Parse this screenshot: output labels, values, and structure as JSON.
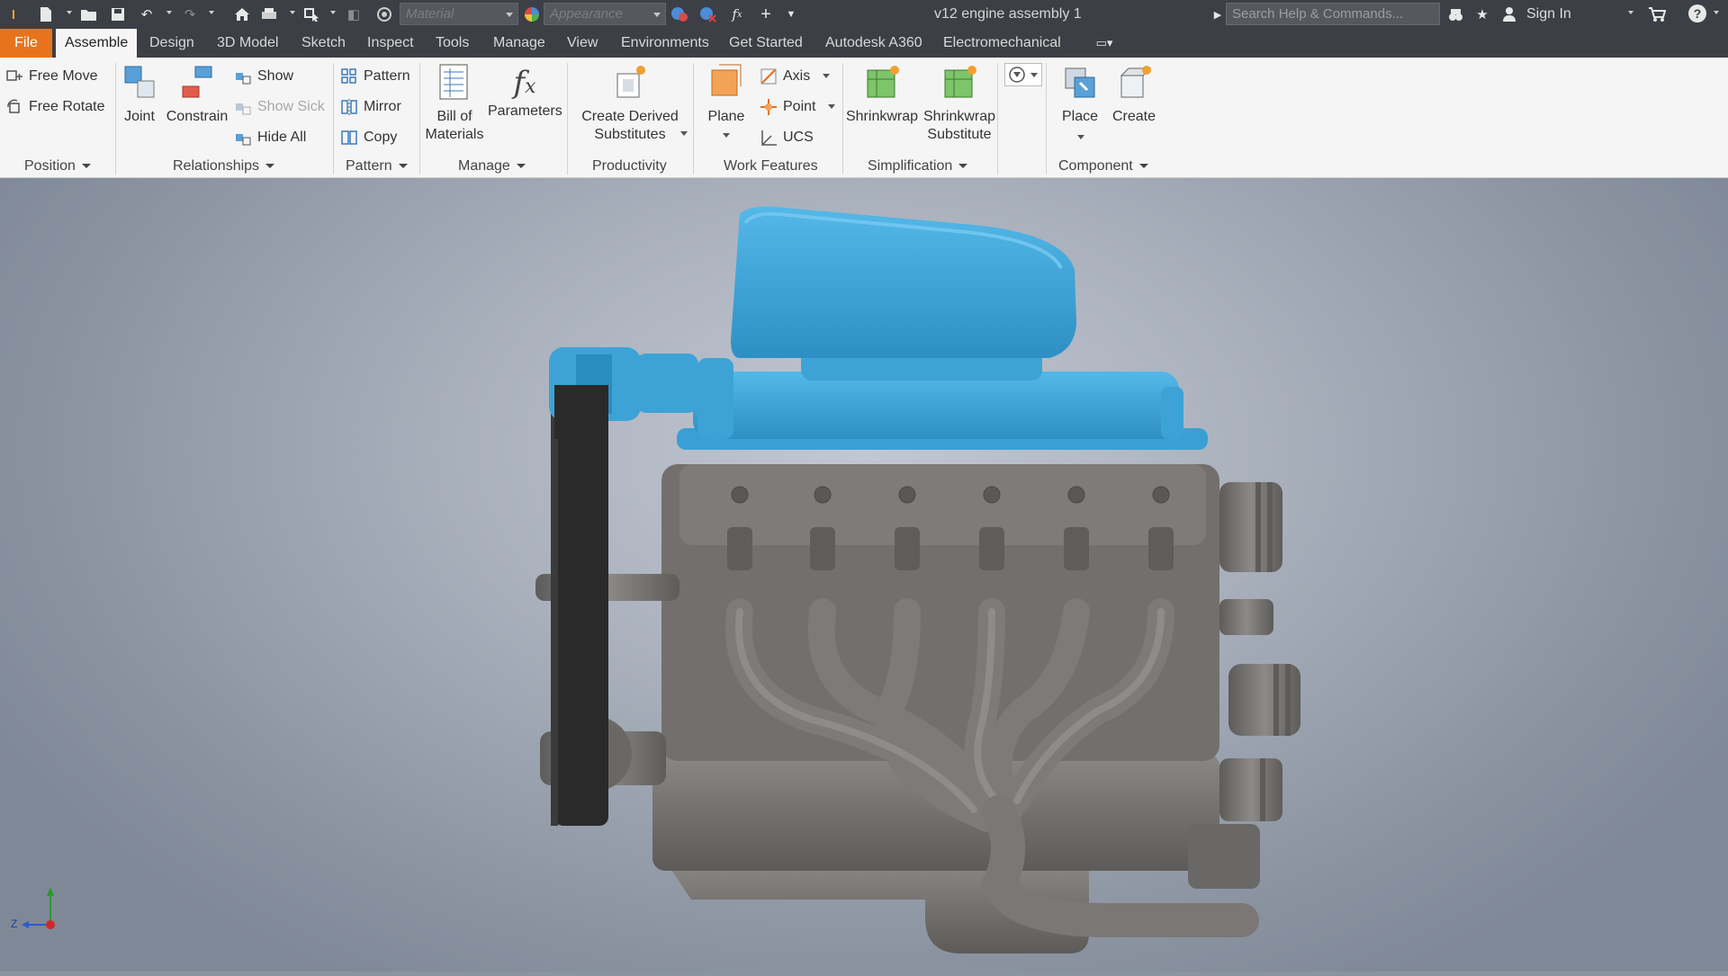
{
  "titlebar": {
    "document_title": "v12 engine assembly 1",
    "material_placeholder": "Material",
    "appearance_placeholder": "Appearance",
    "search_placeholder": "Search Help & Commands...",
    "sign_in": "Sign In",
    "help": "?"
  },
  "tabs": [
    "File",
    "Assemble",
    "Design",
    "3D Model",
    "Sketch",
    "Inspect",
    "Tools",
    "Manage",
    "View",
    "Environments",
    "Get Started",
    "Autodesk A360",
    "Electromechanical"
  ],
  "active_tab": "Assemble",
  "ribbon": {
    "position": {
      "title": "Position",
      "free_move": "Free Move",
      "free_rotate": "Free Rotate"
    },
    "relationships": {
      "title": "Relationships",
      "joint": "Joint",
      "constrain": "Constrain",
      "show": "Show",
      "show_sick": "Show Sick",
      "hide_all": "Hide All"
    },
    "pattern": {
      "title": "Pattern",
      "pattern": "Pattern",
      "mirror": "Mirror",
      "copy": "Copy"
    },
    "manage": {
      "title": "Manage",
      "bom_line1": "Bill of",
      "bom_line2": "Materials",
      "parameters": "Parameters"
    },
    "productivity": {
      "title": "Productivity",
      "derived_line1": "Create Derived",
      "derived_line2": "Substitutes"
    },
    "work_features": {
      "title": "Work Features",
      "plane": "Plane",
      "axis": "Axis",
      "point": "Point",
      "ucs": "UCS"
    },
    "simplification": {
      "title": "Simplification",
      "shrinkwrap": "Shrinkwrap",
      "shrinkwrap_sub_line1": "Shrinkwrap",
      "shrinkwrap_sub_line2": "Substitute"
    },
    "component": {
      "title": "Component",
      "place": "Place",
      "create": "Create"
    }
  },
  "viewport": {
    "triad_label": "Z"
  },
  "colors": {
    "file_tab": "#e7741d",
    "selected_part": "#3da3d6",
    "engine_body": "#6f6d6a",
    "belt": "#2a2a2a"
  }
}
